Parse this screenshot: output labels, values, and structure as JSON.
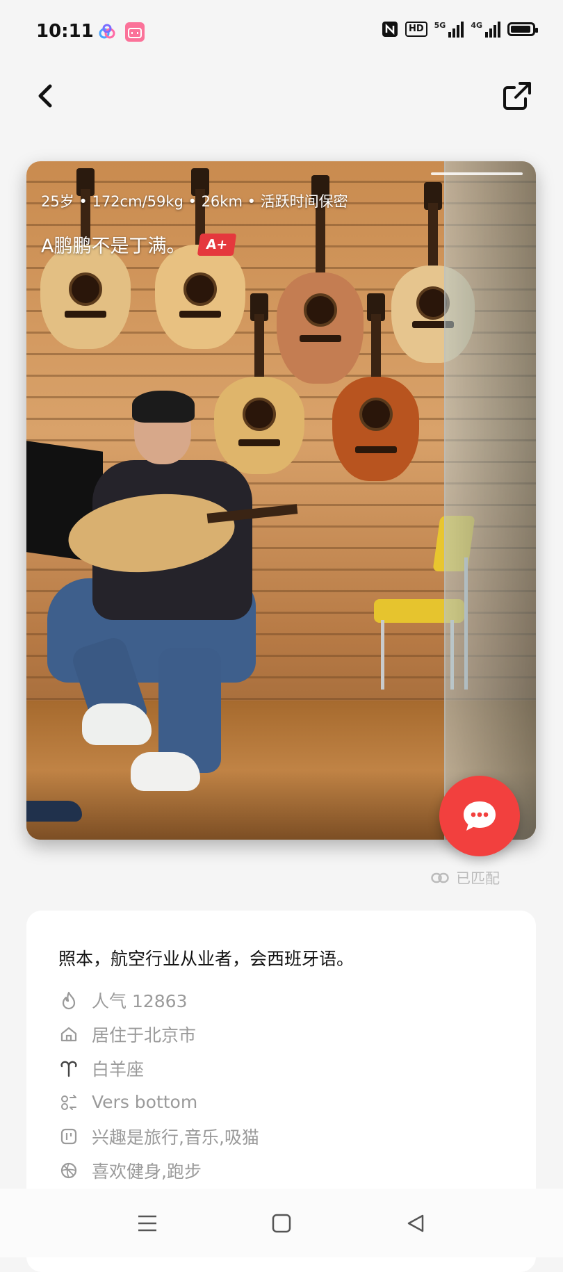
{
  "status_bar": {
    "time": "10:11",
    "hd_badge": "HD",
    "net1": "5G",
    "net2": "4G"
  },
  "header": {
    "back_icon": "chevron-left-icon",
    "share_icon": "share-icon"
  },
  "photo": {
    "info_line": "25岁 • 172cm/59kg • 26km • 活跃时间保密",
    "name": "A鹏鹏不是丁满。",
    "badge": "A+"
  },
  "chat_button_icon": "chat-bubble-icon",
  "match": {
    "label": "已匹配",
    "icon": "link-icon"
  },
  "profile": {
    "bio": "照本，航空行业从业者，会西班牙语。",
    "items": [
      {
        "icon": "flame-icon",
        "text": "人气 12863"
      },
      {
        "icon": "home-icon",
        "text": "居住于北京市"
      },
      {
        "icon": "aries-icon",
        "text": "白羊座"
      },
      {
        "icon": "swap-icon",
        "text": "Vers bottom"
      },
      {
        "icon": "interest-icon",
        "text": "兴趣是旅行,音乐,吸猫"
      },
      {
        "icon": "ball-icon",
        "text": "喜欢健身,跑步"
      }
    ]
  },
  "nav_bar": {
    "menu_icon": "menu-icon",
    "home_icon": "square-home-icon",
    "back_icon": "triangle-back-icon"
  },
  "colors": {
    "accent": "#f2403e",
    "muted_text": "#9a9a9a",
    "background": "#f5f5f5"
  }
}
